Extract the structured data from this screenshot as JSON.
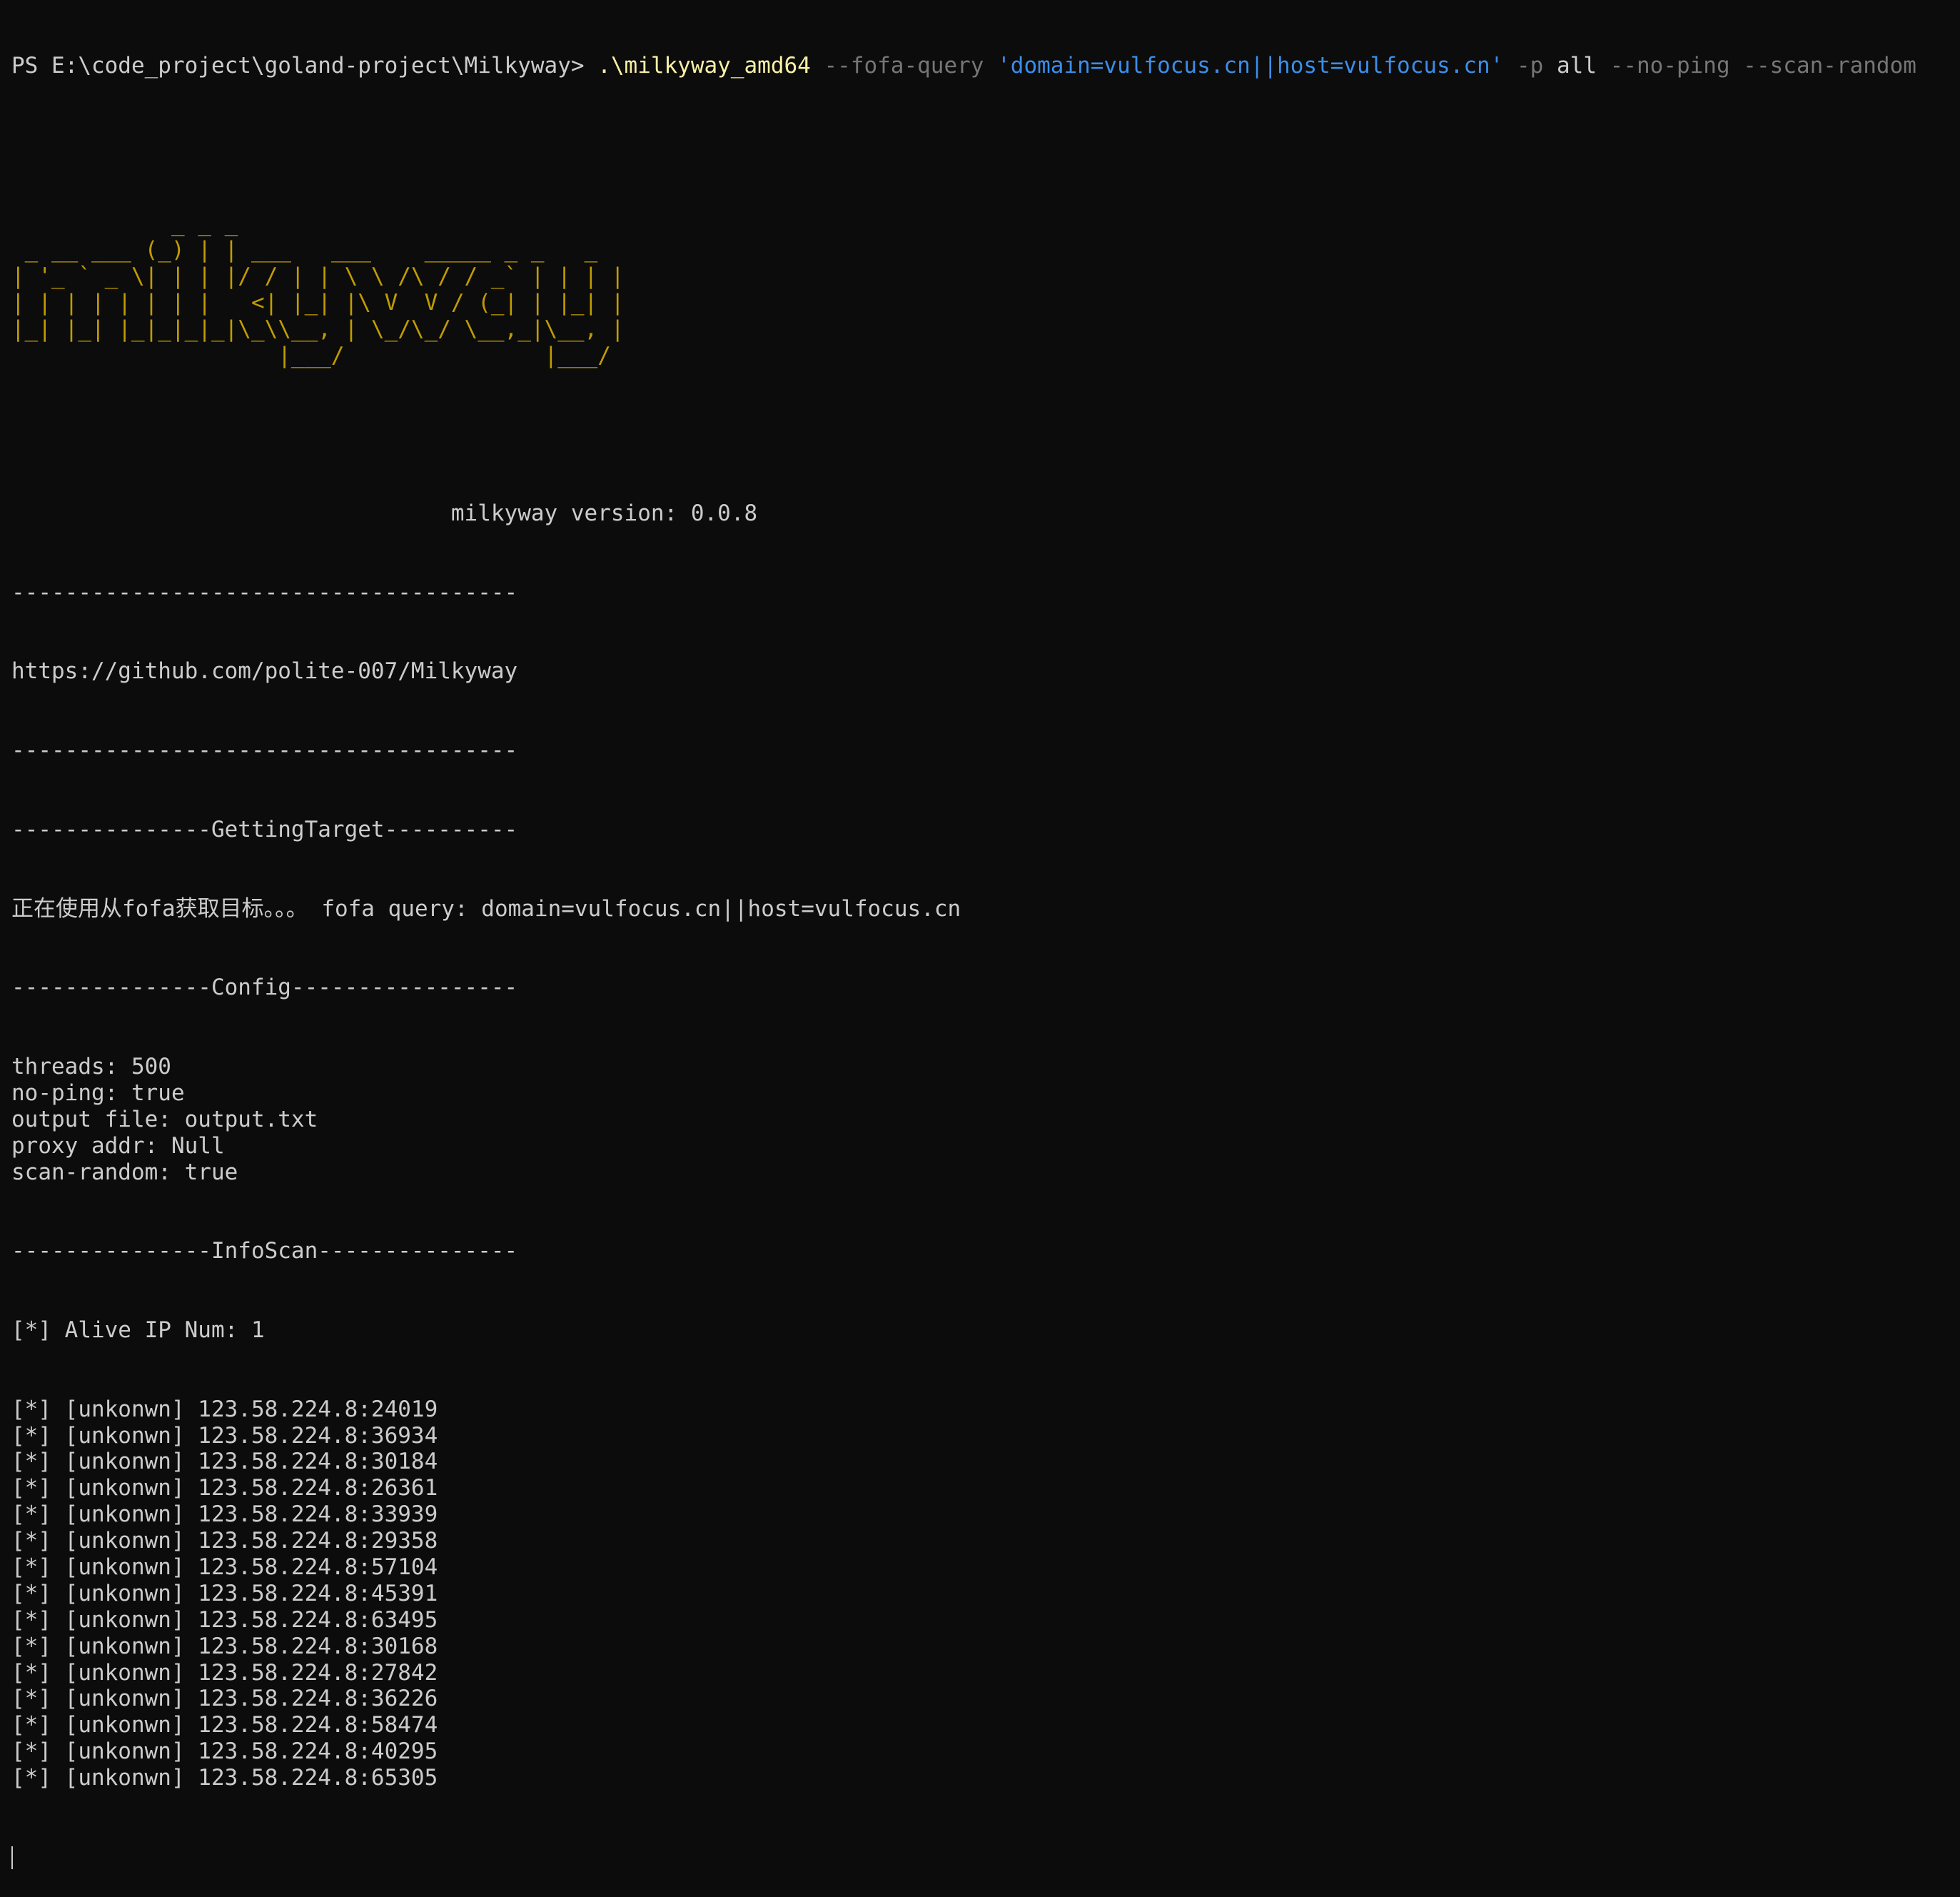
{
  "window": {
    "background": "#0c0c0c",
    "foreground": "#cccccc"
  },
  "prompt": {
    "path": "PS E:\\code_project\\goland-project\\Milkyway> ",
    "executable": ".\\milkyway_amd64",
    "flag_fofa": " --fofa-query ",
    "query_string": "'domain=vulfocus.cn||host=vulfocus.cn'",
    "flag_p": " -p ",
    "p_value": "all",
    "flag_rest": " --no-ping --scan-random"
  },
  "banner": {
    "color": "#c19c00",
    "lines": [
      "            _ _ _",
      " _ __ ___ (_) | | ___   ___    _____ _ _   _",
      "| '_ ` _ \\| | | |/ / | | \\ \\ /\\ / / _` | | | |",
      "| | | | | | | |   <| |_| |\\ V  V / (_| | |_| |",
      "|_| |_| |_|_|_|_|\\_\\\\__, | \\_/\\_/ \\__,_|\\__, |",
      "                    |___/               |___/"
    ]
  },
  "version_line": "                                 milkyway version: 0.0.8",
  "separator": "--------------------------------------",
  "repo_url": "https://github.com/polite-007/Milkyway",
  "section_getting_target": "---------------GettingTarget----------",
  "fofa_status": "正在使用从fofa获取目标。。。 fofa query: domain=vulfocus.cn||host=vulfocus.cn",
  "section_config": "---------------Config-----------------",
  "config": [
    "threads: 500",
    "no-ping: true",
    "output file: output.txt",
    "proxy addr: Null",
    "scan-random: true"
  ],
  "section_infoscan": "---------------InfoScan---------------",
  "alive_ip": "[*] Alive IP Num: 1",
  "results": [
    "[*] [unkonwn] 123.58.224.8:24019",
    "[*] [unkonwn] 123.58.224.8:36934",
    "[*] [unkonwn] 123.58.224.8:30184",
    "[*] [unkonwn] 123.58.224.8:26361",
    "[*] [unkonwn] 123.58.224.8:33939",
    "[*] [unkonwn] 123.58.224.8:29358",
    "[*] [unkonwn] 123.58.224.8:57104",
    "[*] [unkonwn] 123.58.224.8:45391",
    "[*] [unkonwn] 123.58.224.8:63495",
    "[*] [unkonwn] 123.58.224.8:30168",
    "[*] [unkonwn] 123.58.224.8:27842",
    "[*] [unkonwn] 123.58.224.8:36226",
    "[*] [unkonwn] 123.58.224.8:58474",
    "[*] [unkonwn] 123.58.224.8:40295",
    "[*] [unkonwn] 123.58.224.8:65305"
  ]
}
